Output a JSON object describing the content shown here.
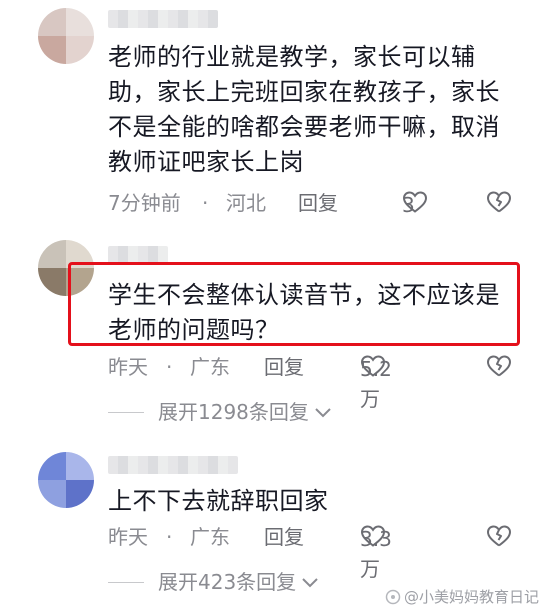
{
  "comments": [
    {
      "text": "老师的行业就是教学，家长可以辅助，家长上完班回家在教孩子，家长不是全能的啥都会要老师干嘛，取消教师证吧家长上岗",
      "time": "7分钟前",
      "sep": "·",
      "location": "河北",
      "reply": "回复",
      "likes": "3"
    },
    {
      "text": "学生不会整体认读音节，这不应该是老师的问题吗？",
      "time": "昨天",
      "sep": "·",
      "location": "广东",
      "reply": "回复",
      "likes": "5.2万",
      "expand": "展开1298条回复"
    },
    {
      "text": "上不下去就辞职回家",
      "time": "昨天",
      "sep": "·",
      "location": "广东",
      "reply": "回复",
      "likes": "3.3万",
      "expand": "展开423条回复"
    }
  ],
  "watermark": "@小美妈妈教育日记",
  "colors": {
    "highlight": "#e4101b",
    "meta": "#8a8b91",
    "text": "#161823"
  }
}
